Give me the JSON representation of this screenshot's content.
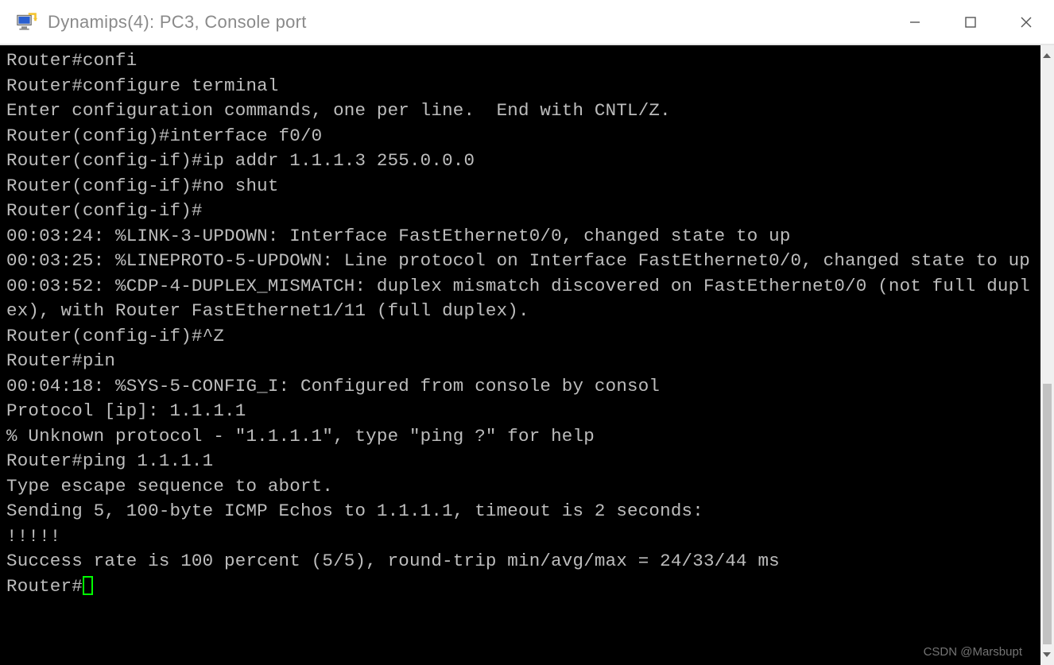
{
  "window": {
    "title": "Dynamips(4): PC3, Console port"
  },
  "terminal": {
    "lines": [
      "Router#confi",
      "Router#configure terminal",
      "Enter configuration commands, one per line.  End with CNTL/Z.",
      "Router(config)#interface f0/0",
      "Router(config-if)#ip addr 1.1.1.3 255.0.0.0",
      "Router(config-if)#no shut",
      "Router(config-if)#",
      "00:03:24: %LINK-3-UPDOWN: Interface FastEthernet0/0, changed state to up",
      "00:03:25: %LINEPROTO-5-UPDOWN: Line protocol on Interface FastEthernet0/0, changed state to up",
      "00:03:52: %CDP-4-DUPLEX_MISMATCH: duplex mismatch discovered on FastEthernet0/0 (not full duplex), with Router FastEthernet1/11 (full duplex).",
      "Router(config-if)#^Z",
      "Router#pin",
      "00:04:18: %SYS-5-CONFIG_I: Configured from console by consol",
      "Protocol [ip]: 1.1.1.1",
      "% Unknown protocol - \"1.1.1.1\", type \"ping ?\" for help",
      "Router#ping 1.1.1.1",
      "",
      "Type escape sequence to abort.",
      "Sending 5, 100-byte ICMP Echos to 1.1.1.1, timeout is 2 seconds:",
      "!!!!!",
      "Success rate is 100 percent (5/5), round-trip min/avg/max = 24/33/44 ms"
    ],
    "prompt": "Router#"
  },
  "watermark": "CSDN @Marsbupt"
}
